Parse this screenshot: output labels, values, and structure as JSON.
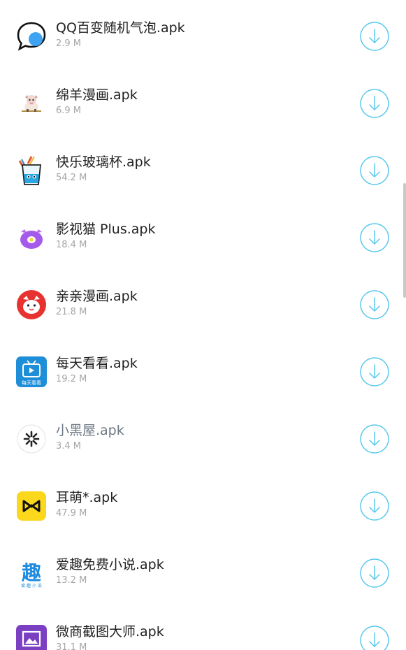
{
  "accent_color": "#5ac8ec",
  "items": [
    {
      "name": "QQ百变随机气泡.apk",
      "size": "2.9 M",
      "icon": "speech-bubble-icon"
    },
    {
      "name": "绵羊漫画.apk",
      "size": "6.9 M",
      "icon": "sheep-icon"
    },
    {
      "name": "快乐玻璃杯.apk",
      "size": "54.2 M",
      "icon": "glass-cup-icon"
    },
    {
      "name": "影视猫 Plus.apk",
      "size": "18.4 M",
      "icon": "cat-face-icon"
    },
    {
      "name": "亲亲漫画.apk",
      "size": "21.8 M",
      "icon": "red-cat-icon"
    },
    {
      "name": "每天看看.apk",
      "size": "19.2 M",
      "icon": "tv-icon"
    },
    {
      "name": "小黑屋.apk",
      "size": "3.4 M",
      "icon": "snowflake-icon"
    },
    {
      "name": "耳萌*.apk",
      "size": "47.9 M",
      "icon": "bowtie-icon"
    },
    {
      "name": "爱趣免费小说.apk",
      "size": "13.2 M",
      "icon": "qu-character-icon"
    },
    {
      "name": "微商截图大师.apk",
      "size": "31.1 M",
      "icon": "picture-frame-icon"
    }
  ],
  "icon_text": {
    "tv": "每天看看",
    "qu": "趣",
    "qu_sub": "爱 趣 小 说"
  }
}
